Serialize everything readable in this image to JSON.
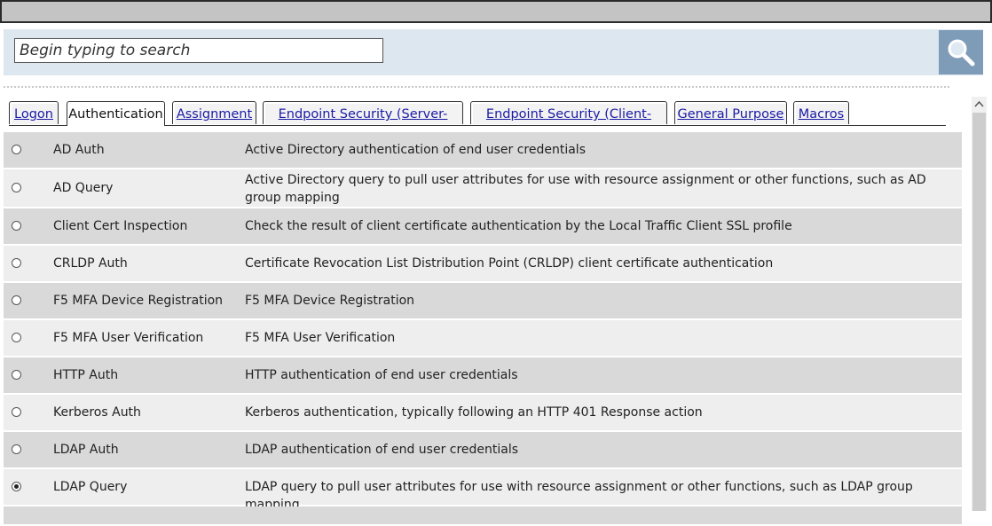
{
  "search": {
    "placeholder": "Begin typing to search",
    "button_icon": "search-icon"
  },
  "tabs": [
    {
      "label": "Logon",
      "active": false
    },
    {
      "label": "Authentication",
      "active": true
    },
    {
      "label": "Assignment",
      "active": false
    },
    {
      "label": "Endpoint Security (Server-Side)",
      "active": false
    },
    {
      "label": "Endpoint Security (Client-Side)",
      "active": false
    },
    {
      "label": "General Purpose",
      "active": false
    },
    {
      "label": "Macros",
      "active": false
    }
  ],
  "items": [
    {
      "name": "AD Auth",
      "description": "Active Directory authentication of end user credentials",
      "selected": false
    },
    {
      "name": "AD Query",
      "description": "Active Directory query to pull user attributes for use with resource assignment or other functions, such as AD group mapping",
      "selected": false
    },
    {
      "name": "Client Cert Inspection",
      "description": "Check the result of client certificate authentication by the Local Traffic Client SSL profile",
      "selected": false
    },
    {
      "name": "CRLDP Auth",
      "description": "Certificate Revocation List Distribution Point (CRLDP) client certificate authentication",
      "selected": false
    },
    {
      "name": "F5 MFA Device Registration",
      "description": "F5 MFA Device Registration",
      "selected": false
    },
    {
      "name": "F5 MFA User Verification",
      "description": "F5 MFA User Verification",
      "selected": false
    },
    {
      "name": "HTTP Auth",
      "description": "HTTP authentication of end user credentials",
      "selected": false
    },
    {
      "name": "Kerberos Auth",
      "description": "Kerberos authentication, typically following an HTTP 401 Response action",
      "selected": false
    },
    {
      "name": "LDAP Auth",
      "description": "LDAP authentication of end user credentials",
      "selected": false
    },
    {
      "name": "LDAP Query",
      "description": "LDAP query to pull user attributes for use with resource assignment or other functions, such as LDAP group mapping",
      "selected": true
    }
  ],
  "colors": {
    "search_bg": "#dde7ef",
    "search_button": "#7e9cb8",
    "row_dark": "#d9d9d9",
    "row_light": "#eeeeee",
    "link": "#1a1aa6"
  }
}
